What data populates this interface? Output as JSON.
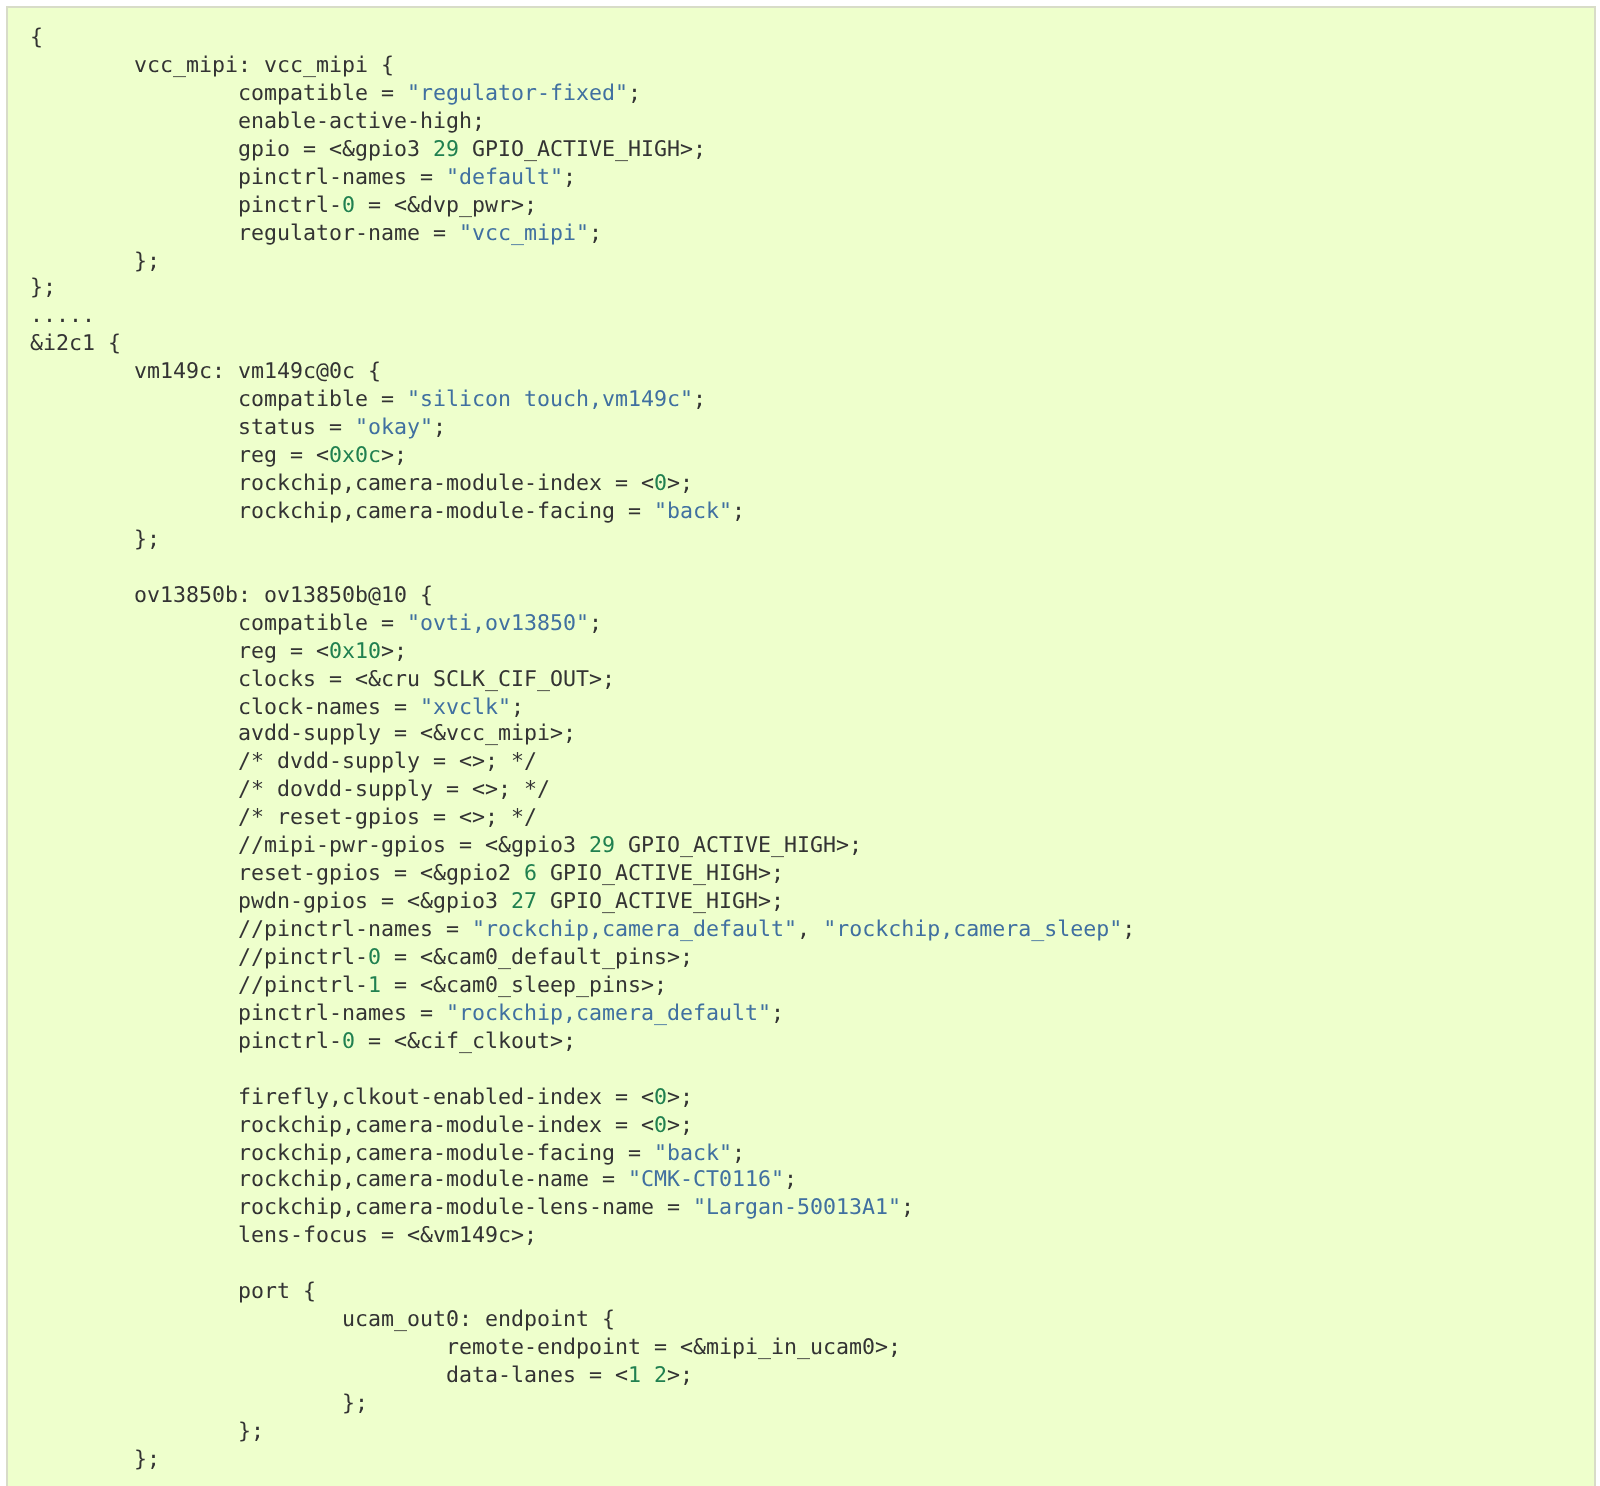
{
  "code_block": {
    "lines": [
      [
        {
          "kind": "plain",
          "text": "{"
        }
      ],
      [
        {
          "kind": "plain",
          "text": "\tvcc_mipi: vcc_mipi {"
        }
      ],
      [
        {
          "kind": "plain",
          "text": "\t\tcompatible = "
        },
        {
          "kind": "string",
          "text": "\"regulator-fixed\""
        },
        {
          "kind": "plain",
          "text": ";"
        }
      ],
      [
        {
          "kind": "plain",
          "text": "\t\tenable-active-high;"
        }
      ],
      [
        {
          "kind": "plain",
          "text": "\t\tgpio = <&gpio3 "
        },
        {
          "kind": "number",
          "text": "29"
        },
        {
          "kind": "plain",
          "text": " GPIO_ACTIVE_HIGH>;"
        }
      ],
      [
        {
          "kind": "plain",
          "text": "\t\tpinctrl-names = "
        },
        {
          "kind": "string",
          "text": "\"default\""
        },
        {
          "kind": "plain",
          "text": ";"
        }
      ],
      [
        {
          "kind": "plain",
          "text": "\t\tpinctrl-"
        },
        {
          "kind": "number",
          "text": "0"
        },
        {
          "kind": "plain",
          "text": " = <&dvp_pwr>;"
        }
      ],
      [
        {
          "kind": "plain",
          "text": "\t\tregulator-name = "
        },
        {
          "kind": "string",
          "text": "\"vcc_mipi\""
        },
        {
          "kind": "plain",
          "text": ";"
        }
      ],
      [
        {
          "kind": "plain",
          "text": "\t};"
        }
      ],
      [
        {
          "kind": "plain",
          "text": "};"
        }
      ],
      [
        {
          "kind": "plain",
          "text": "....."
        }
      ],
      [
        {
          "kind": "plain",
          "text": "&i2c1 {"
        }
      ],
      [
        {
          "kind": "plain",
          "text": "\tvm149c: vm149c@0c {"
        }
      ],
      [
        {
          "kind": "plain",
          "text": "\t\tcompatible = "
        },
        {
          "kind": "string",
          "text": "\"silicon touch,vm149c\""
        },
        {
          "kind": "plain",
          "text": ";"
        }
      ],
      [
        {
          "kind": "plain",
          "text": "\t\tstatus = "
        },
        {
          "kind": "string",
          "text": "\"okay\""
        },
        {
          "kind": "plain",
          "text": ";"
        }
      ],
      [
        {
          "kind": "plain",
          "text": "\t\treg = <"
        },
        {
          "kind": "number",
          "text": "0x0c"
        },
        {
          "kind": "plain",
          "text": ">;"
        }
      ],
      [
        {
          "kind": "plain",
          "text": "\t\trockchip,camera-module-index = <"
        },
        {
          "kind": "number",
          "text": "0"
        },
        {
          "kind": "plain",
          "text": ">;"
        }
      ],
      [
        {
          "kind": "plain",
          "text": "\t\trockchip,camera-module-facing = "
        },
        {
          "kind": "string",
          "text": "\"back\""
        },
        {
          "kind": "plain",
          "text": ";"
        }
      ],
      [
        {
          "kind": "plain",
          "text": "\t};"
        }
      ],
      [
        {
          "kind": "blank"
        }
      ],
      [
        {
          "kind": "plain",
          "text": "\tov13850b: ov13850b@10 {"
        }
      ],
      [
        {
          "kind": "plain",
          "text": "\t\tcompatible = "
        },
        {
          "kind": "string",
          "text": "\"ovti,ov13850\""
        },
        {
          "kind": "plain",
          "text": ";"
        }
      ],
      [
        {
          "kind": "plain",
          "text": "\t\treg = <"
        },
        {
          "kind": "number",
          "text": "0x10"
        },
        {
          "kind": "plain",
          "text": ">;"
        }
      ],
      [
        {
          "kind": "plain",
          "text": "\t\tclocks = <&cru SCLK_CIF_OUT>;"
        }
      ],
      [
        {
          "kind": "plain",
          "text": "\t\tclock-names = "
        },
        {
          "kind": "string",
          "text": "\"xvclk\""
        },
        {
          "kind": "plain",
          "text": ";"
        }
      ],
      [
        {
          "kind": "plain",
          "text": "\t\tavdd-supply = <&vcc_mipi>;"
        }
      ],
      [
        {
          "kind": "plain",
          "text": "\t\t/* dvdd-supply = <>; */"
        }
      ],
      [
        {
          "kind": "plain",
          "text": "\t\t/* dovdd-supply = <>; */"
        }
      ],
      [
        {
          "kind": "plain",
          "text": "\t\t/* reset-gpios = <>; */"
        }
      ],
      [
        {
          "kind": "plain",
          "text": "\t\t//mipi-pwr-gpios = <&gpio3 "
        },
        {
          "kind": "number",
          "text": "29"
        },
        {
          "kind": "plain",
          "text": " GPIO_ACTIVE_HIGH>;"
        }
      ],
      [
        {
          "kind": "plain",
          "text": "\t\treset-gpios = <&gpio2 "
        },
        {
          "kind": "number",
          "text": "6"
        },
        {
          "kind": "plain",
          "text": " GPIO_ACTIVE_HIGH>;"
        }
      ],
      [
        {
          "kind": "plain",
          "text": "\t\tpwdn-gpios = <&gpio3 "
        },
        {
          "kind": "number",
          "text": "27"
        },
        {
          "kind": "plain",
          "text": " GPIO_ACTIVE_HIGH>;"
        }
      ],
      [
        {
          "kind": "plain",
          "text": "\t\t//pinctrl-names = "
        },
        {
          "kind": "string",
          "text": "\"rockchip,camera_default\""
        },
        {
          "kind": "plain",
          "text": ", "
        },
        {
          "kind": "string",
          "text": "\"rockchip,camera_sleep\""
        },
        {
          "kind": "plain",
          "text": ";"
        }
      ],
      [
        {
          "kind": "plain",
          "text": "\t\t//pinctrl-"
        },
        {
          "kind": "number",
          "text": "0"
        },
        {
          "kind": "plain",
          "text": " = <&cam0_default_pins>;"
        }
      ],
      [
        {
          "kind": "plain",
          "text": "\t\t//pinctrl-"
        },
        {
          "kind": "number",
          "text": "1"
        },
        {
          "kind": "plain",
          "text": " = <&cam0_sleep_pins>;"
        }
      ],
      [
        {
          "kind": "plain",
          "text": "\t\tpinctrl-names = "
        },
        {
          "kind": "string",
          "text": "\"rockchip,camera_default\""
        },
        {
          "kind": "plain",
          "text": ";"
        }
      ],
      [
        {
          "kind": "plain",
          "text": "\t\tpinctrl-"
        },
        {
          "kind": "number",
          "text": "0"
        },
        {
          "kind": "plain",
          "text": " = <&cif_clkout>;"
        }
      ],
      [
        {
          "kind": "blank"
        }
      ],
      [
        {
          "kind": "plain",
          "text": "\t\tfirefly,clkout-enabled-index = <"
        },
        {
          "kind": "number",
          "text": "0"
        },
        {
          "kind": "plain",
          "text": ">;"
        }
      ],
      [
        {
          "kind": "plain",
          "text": "\t\trockchip,camera-module-index = <"
        },
        {
          "kind": "number",
          "text": "0"
        },
        {
          "kind": "plain",
          "text": ">;"
        }
      ],
      [
        {
          "kind": "plain",
          "text": "\t\trockchip,camera-module-facing = "
        },
        {
          "kind": "string",
          "text": "\"back\""
        },
        {
          "kind": "plain",
          "text": ";"
        }
      ],
      [
        {
          "kind": "plain",
          "text": "\t\trockchip,camera-module-name = "
        },
        {
          "kind": "string",
          "text": "\"CMK-CT0116\""
        },
        {
          "kind": "plain",
          "text": ";"
        }
      ],
      [
        {
          "kind": "plain",
          "text": "\t\trockchip,camera-module-lens-name = "
        },
        {
          "kind": "string",
          "text": "\"Largan-50013A1\""
        },
        {
          "kind": "plain",
          "text": ";"
        }
      ],
      [
        {
          "kind": "plain",
          "text": "\t\tlens-focus = <&vm149c>;"
        }
      ],
      [
        {
          "kind": "blank"
        }
      ],
      [
        {
          "kind": "plain",
          "text": "\t\tport {"
        }
      ],
      [
        {
          "kind": "plain",
          "text": "\t\t\tucam_out0: endpoint {"
        }
      ],
      [
        {
          "kind": "plain",
          "text": "\t\t\t\tremote-endpoint = <&mipi_in_ucam0>;"
        }
      ],
      [
        {
          "kind": "plain",
          "text": "\t\t\t\tdata-lanes = <"
        },
        {
          "kind": "number",
          "text": "1 2"
        },
        {
          "kind": "plain",
          "text": ">;"
        }
      ],
      [
        {
          "kind": "plain",
          "text": "\t\t\t};"
        }
      ],
      [
        {
          "kind": "plain",
          "text": "\t\t};"
        }
      ],
      [
        {
          "kind": "plain",
          "text": "\t};"
        }
      ]
    ]
  }
}
